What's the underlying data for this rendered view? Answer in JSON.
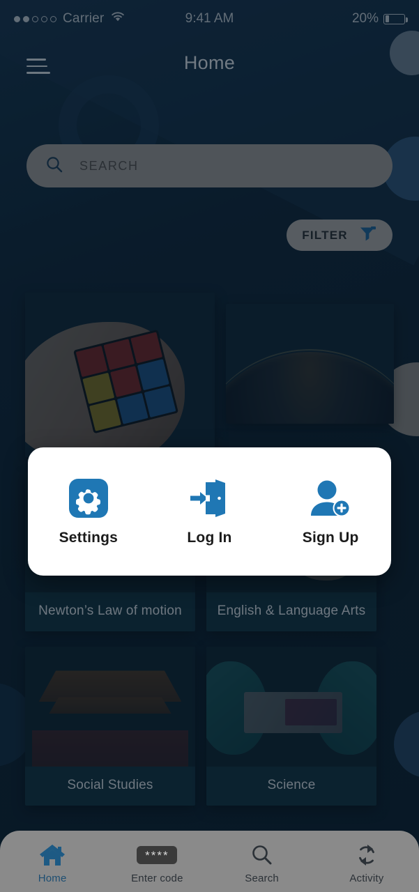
{
  "status_bar": {
    "carrier": "Carrier",
    "signal_dots_filled": 2,
    "signal_dots_total": 5,
    "wifi_icon": "wifi-icon",
    "time": "9:41 AM",
    "battery_percent": "20%",
    "battery_icon": "battery-icon"
  },
  "header": {
    "menu_icon": "hamburger-menu-icon",
    "title": "Home"
  },
  "search": {
    "icon": "search-icon",
    "placeholder": "SEARCH",
    "value": ""
  },
  "filter": {
    "label": "FILTER",
    "icon": "funnel-filter-icon"
  },
  "cards": [
    {
      "title": "",
      "image": "hand-holding-rubiks-cube",
      "featured": true
    },
    {
      "title": "",
      "image": "earth-from-space-at-night",
      "featured": false
    },
    {
      "title": "Newton’s Law of motion",
      "image": "red-book-on-dark-desk",
      "featured": false
    },
    {
      "title": "English & Language Arts",
      "image": "hand-writing-closeup",
      "featured": false
    },
    {
      "title": "Social Studies",
      "image": "tiananmen-gate-beijing",
      "featured": false
    },
    {
      "title": "Science",
      "image": "gloved-hands-holding-microchip",
      "featured": false
    }
  ],
  "modal": {
    "items": [
      {
        "label": "Settings",
        "icon": "gear-settings-icon"
      },
      {
        "label": "Log In",
        "icon": "login-door-arrow-icon"
      },
      {
        "label": "Sign Up",
        "icon": "person-add-icon"
      }
    ]
  },
  "bottom_nav": {
    "items": [
      {
        "label": "Home",
        "icon": "home-icon",
        "active": true
      },
      {
        "label": "Enter code",
        "icon": "code-asterisks-icon",
        "asterisks": "****",
        "active": false
      },
      {
        "label": "Search",
        "icon": "search-icon",
        "active": false
      },
      {
        "label": "Activity",
        "icon": "refresh-activity-icon",
        "active": false
      }
    ]
  },
  "colors": {
    "background": "#0c2233",
    "accent_blue": "#1f77b4",
    "nav_bar": "#8a8a8a",
    "search_bar": "#8b8b8b",
    "modal_bg": "#ffffff",
    "card_caption_bg": "#10303f"
  }
}
